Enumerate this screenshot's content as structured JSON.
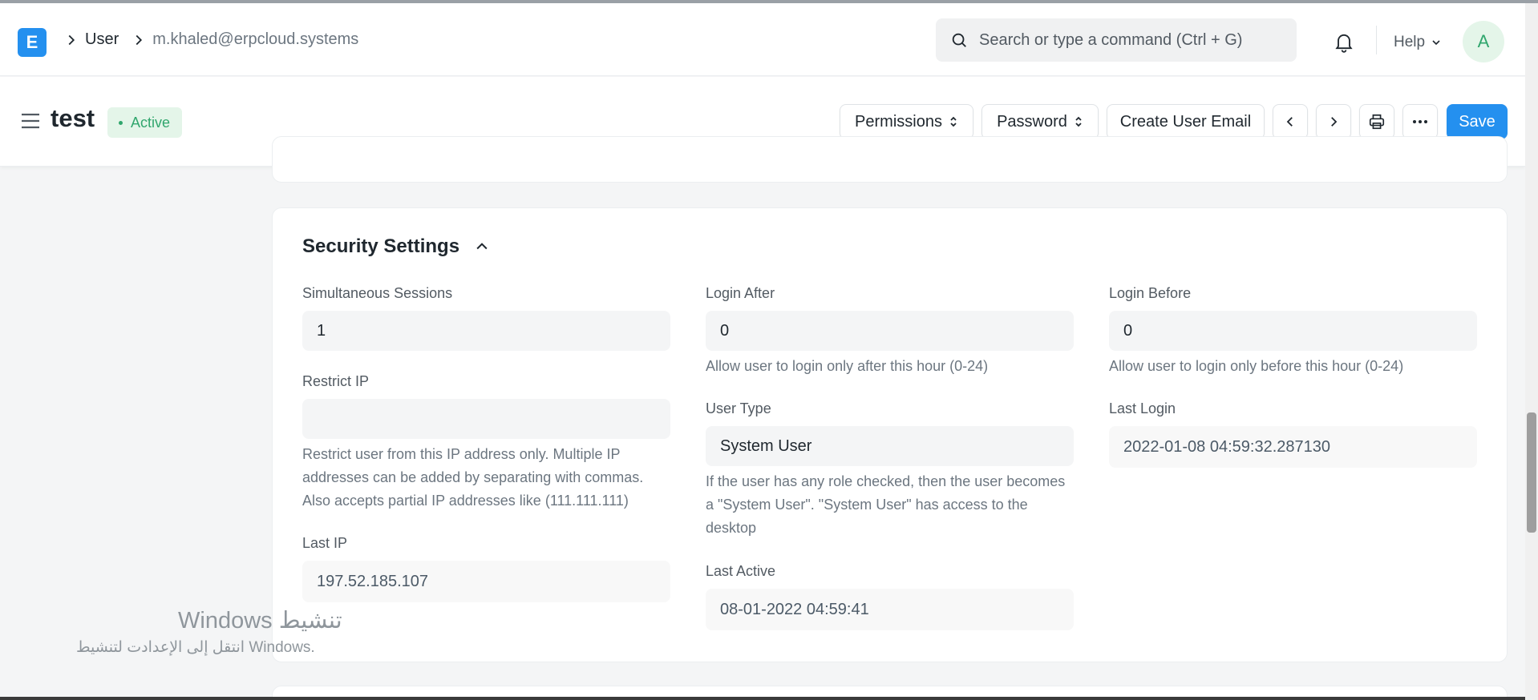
{
  "navbar": {
    "logo_letter": "E",
    "breadcrumbs": [
      "User",
      "m.khaled@erpcloud.systems"
    ],
    "search_placeholder": "Search or type a command (Ctrl + G)",
    "help_label": "Help",
    "avatar_initial": "A"
  },
  "page": {
    "title": "test",
    "status": "Active",
    "buttons": {
      "permissions": "Permissions",
      "password": "Password",
      "create_user_email": "Create User Email",
      "save": "Save"
    }
  },
  "security": {
    "title": "Security Settings",
    "simultaneous_sessions": {
      "label": "Simultaneous Sessions",
      "value": "1"
    },
    "restrict_ip": {
      "label": "Restrict IP",
      "value": "",
      "description": "Restrict user from this IP address only. Multiple IP addresses can be added by separating with commas. Also accepts partial IP addresses like (111.111.111)"
    },
    "last_ip": {
      "label": "Last IP",
      "value": "197.52.185.107"
    },
    "login_after": {
      "label": "Login After",
      "value": "0",
      "description": "Allow user to login only after this hour (0-24)"
    },
    "user_type": {
      "label": "User Type",
      "value": "System User",
      "description": "If the user has any role checked, then the user becomes a \"System User\". \"System User\" has access to the desktop"
    },
    "last_active": {
      "label": "Last Active",
      "value": "08-01-2022 04:59:41"
    },
    "login_before": {
      "label": "Login Before",
      "value": "0",
      "description": "Allow user to login only before this hour (0-24)"
    },
    "last_login": {
      "label": "Last Login",
      "value": "2022-01-08 04:59:32.287130"
    }
  },
  "watermark": {
    "line1": "تنشيط Windows",
    "line2": "انتقل إلى الإعدادت لتنشيط Windows."
  },
  "colors": {
    "accent": "#2490ef",
    "status_green": "#30a66d"
  }
}
